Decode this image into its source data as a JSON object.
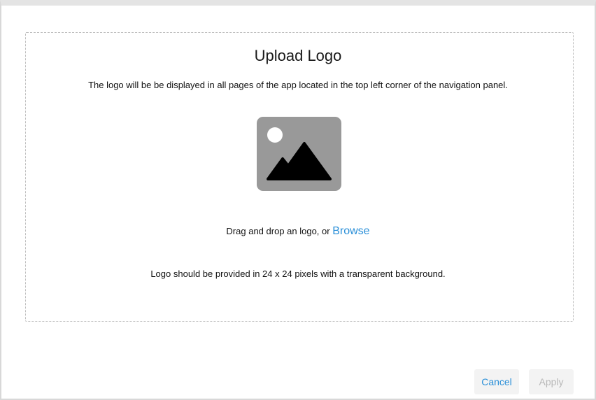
{
  "dialog": {
    "title": "Upload Logo",
    "description": "The logo will be be displayed in all pages of the app located in the top left corner of the navigation panel.",
    "drop_prompt": "Drag and drop an logo, or ",
    "browse_label": "Browse",
    "hint": "Logo should be provided in 24 x 24 pixels with a transparent background.",
    "placeholder_icon": "image-icon"
  },
  "footer": {
    "cancel_label": "Cancel",
    "apply_label": "Apply",
    "apply_enabled": false
  },
  "colors": {
    "accent": "#2a8fd8",
    "placeholder_bg": "#999999",
    "disabled_text": "#b8b8b8"
  }
}
